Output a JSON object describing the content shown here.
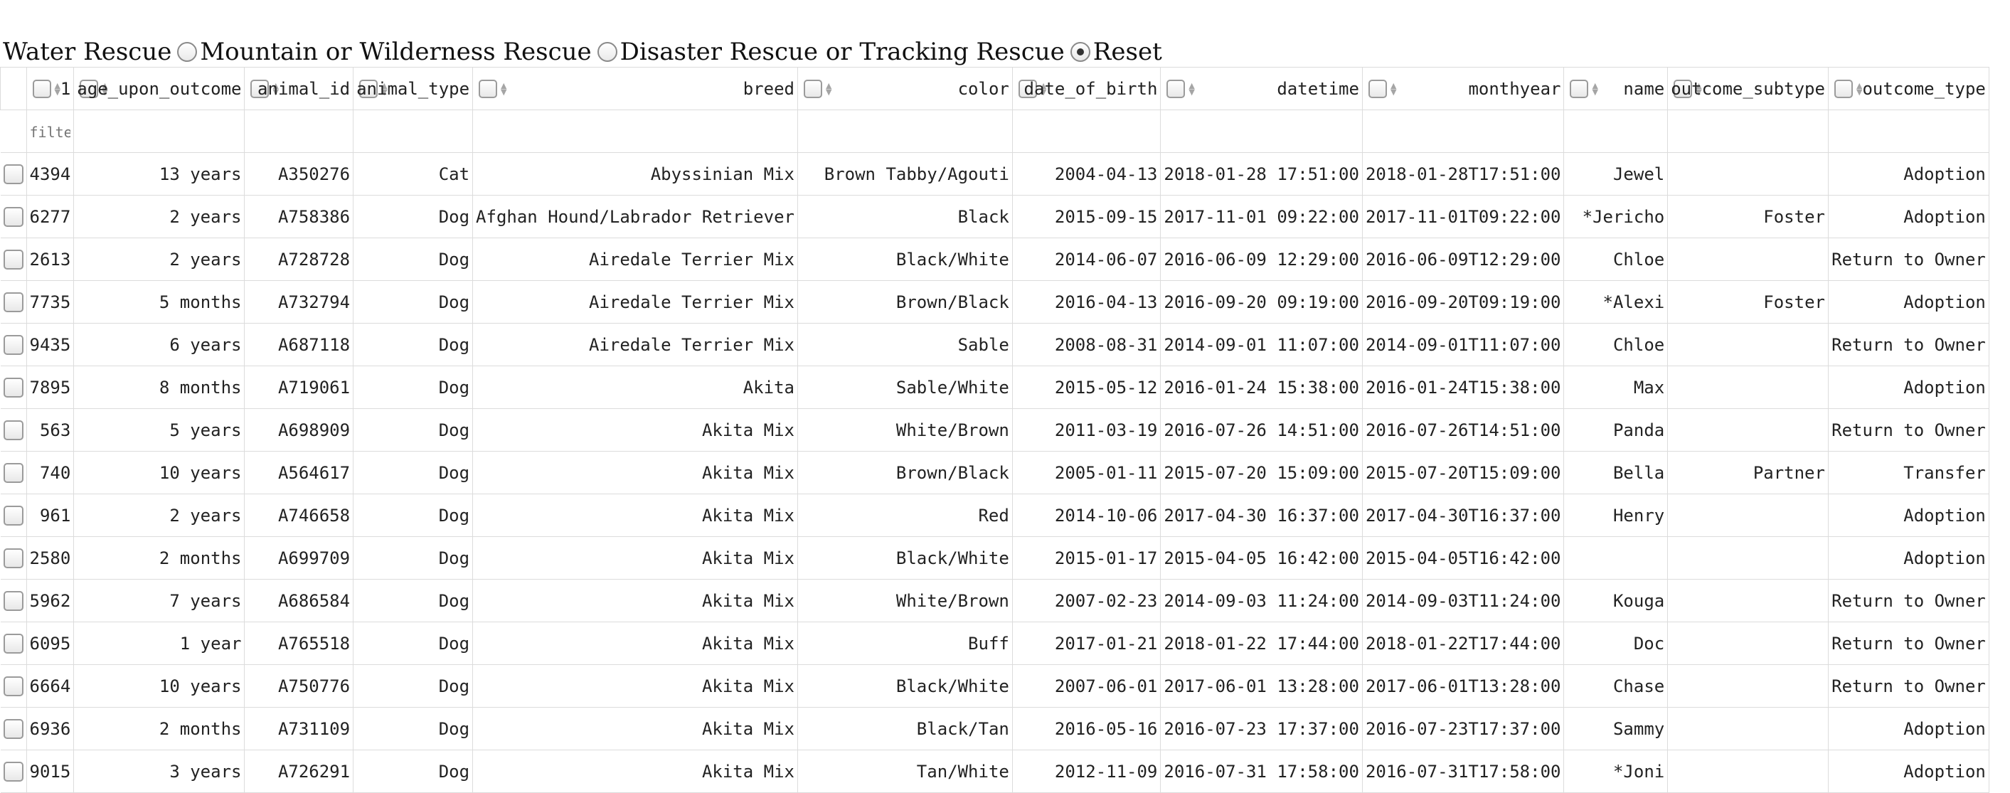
{
  "radio_options": [
    {
      "label": "Water Rescue",
      "checked": false
    },
    {
      "label": "Mountain or Wilderness Rescue",
      "checked": false
    },
    {
      "label": "Disaster Rescue or Tracking Rescue",
      "checked": false
    },
    {
      "label": "Reset",
      "checked": true
    }
  ],
  "table": {
    "index_header": "1",
    "filter_placeholder": "filte",
    "headers": [
      "age_upon_outcome",
      "animal_id",
      "animal_type",
      "breed",
      "color",
      "date_of_birth",
      "datetime",
      "monthyear",
      "name",
      "outcome_subtype",
      "outcome_type"
    ],
    "rows": [
      {
        "index": "4394",
        "cells": [
          "13 years",
          "A350276",
          "Cat",
          "Abyssinian Mix",
          "Brown Tabby/Agouti",
          "2004-04-13",
          "2018-01-28 17:51:00",
          "2018-01-28T17:51:00",
          "Jewel",
          "",
          "Adoption"
        ]
      },
      {
        "index": "6277",
        "cells": [
          "2 years",
          "A758386",
          "Dog",
          "Afghan Hound/Labrador Retriever",
          "Black",
          "2015-09-15",
          "2017-11-01 09:22:00",
          "2017-11-01T09:22:00",
          "*Jericho",
          "Foster",
          "Adoption"
        ]
      },
      {
        "index": "2613",
        "cells": [
          "2 years",
          "A728728",
          "Dog",
          "Airedale Terrier Mix",
          "Black/White",
          "2014-06-07",
          "2016-06-09 12:29:00",
          "2016-06-09T12:29:00",
          "Chloe",
          "",
          "Return to Owner"
        ]
      },
      {
        "index": "7735",
        "cells": [
          "5 months",
          "A732794",
          "Dog",
          "Airedale Terrier Mix",
          "Brown/Black",
          "2016-04-13",
          "2016-09-20 09:19:00",
          "2016-09-20T09:19:00",
          "*Alexi",
          "Foster",
          "Adoption"
        ]
      },
      {
        "index": "9435",
        "cells": [
          "6 years",
          "A687118",
          "Dog",
          "Airedale Terrier Mix",
          "Sable",
          "2008-08-31",
          "2014-09-01 11:07:00",
          "2014-09-01T11:07:00",
          "Chloe",
          "",
          "Return to Owner"
        ]
      },
      {
        "index": "7895",
        "cells": [
          "8 months",
          "A719061",
          "Dog",
          "Akita",
          "Sable/White",
          "2015-05-12",
          "2016-01-24 15:38:00",
          "2016-01-24T15:38:00",
          "Max",
          "",
          "Adoption"
        ]
      },
      {
        "index": "563",
        "cells": [
          "5 years",
          "A698909",
          "Dog",
          "Akita Mix",
          "White/Brown",
          "2011-03-19",
          "2016-07-26 14:51:00",
          "2016-07-26T14:51:00",
          "Panda",
          "",
          "Return to Owner"
        ]
      },
      {
        "index": "740",
        "cells": [
          "10 years",
          "A564617",
          "Dog",
          "Akita Mix",
          "Brown/Black",
          "2005-01-11",
          "2015-07-20 15:09:00",
          "2015-07-20T15:09:00",
          "Bella",
          "Partner",
          "Transfer"
        ]
      },
      {
        "index": "961",
        "cells": [
          "2 years",
          "A746658",
          "Dog",
          "Akita Mix",
          "Red",
          "2014-10-06",
          "2017-04-30 16:37:00",
          "2017-04-30T16:37:00",
          "Henry",
          "",
          "Adoption"
        ]
      },
      {
        "index": "2580",
        "cells": [
          "2 months",
          "A699709",
          "Dog",
          "Akita Mix",
          "Black/White",
          "2015-01-17",
          "2015-04-05 16:42:00",
          "2015-04-05T16:42:00",
          "",
          "",
          "Adoption"
        ]
      },
      {
        "index": "5962",
        "cells": [
          "7 years",
          "A686584",
          "Dog",
          "Akita Mix",
          "White/Brown",
          "2007-02-23",
          "2014-09-03 11:24:00",
          "2014-09-03T11:24:00",
          "Kouga",
          "",
          "Return to Owner"
        ]
      },
      {
        "index": "6095",
        "cells": [
          "1 year",
          "A765518",
          "Dog",
          "Akita Mix",
          "Buff",
          "2017-01-21",
          "2018-01-22 17:44:00",
          "2018-01-22T17:44:00",
          "Doc",
          "",
          "Return to Owner"
        ]
      },
      {
        "index": "6664",
        "cells": [
          "10 years",
          "A750776",
          "Dog",
          "Akita Mix",
          "Black/White",
          "2007-06-01",
          "2017-06-01 13:28:00",
          "2017-06-01T13:28:00",
          "Chase",
          "",
          "Return to Owner"
        ]
      },
      {
        "index": "6936",
        "cells": [
          "2 months",
          "A731109",
          "Dog",
          "Akita Mix",
          "Black/Tan",
          "2016-05-16",
          "2016-07-23 17:37:00",
          "2016-07-23T17:37:00",
          "Sammy",
          "",
          "Adoption"
        ]
      },
      {
        "index": "9015",
        "cells": [
          "3 years",
          "A726291",
          "Dog",
          "Akita Mix",
          "Tan/White",
          "2012-11-09",
          "2016-07-31 17:58:00",
          "2016-07-31T17:58:00",
          "*Joni",
          "",
          "Adoption"
        ]
      }
    ]
  }
}
